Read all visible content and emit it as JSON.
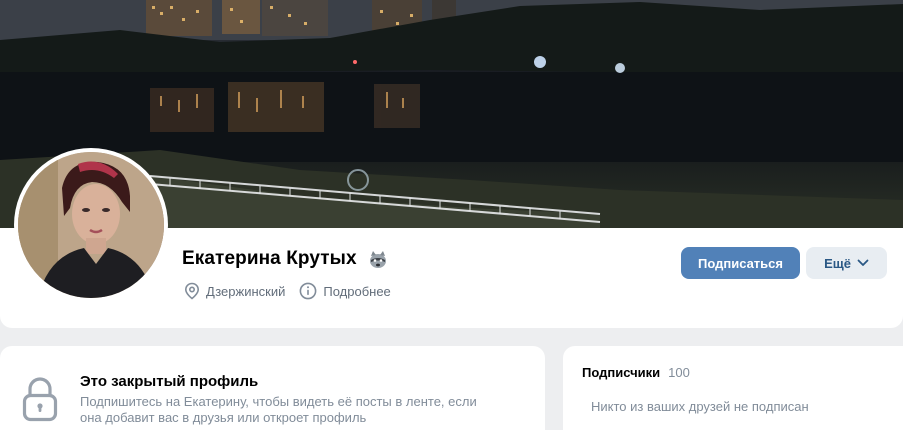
{
  "profile": {
    "name": "Екатерина Крутых",
    "city": "Дзержинский",
    "details_label": "Подробнее"
  },
  "actions": {
    "subscribe_label": "Подписаться",
    "more_label": "Ещё"
  },
  "private_profile": {
    "title": "Это закрытый профиль",
    "description": "Подпишитесь на Екатерину, чтобы видеть её посты в ленте, если она добавит вас в друзья или откроет профиль"
  },
  "followers": {
    "title": "Подписчики",
    "count": "100",
    "empty_text": "Никто из ваших друзей не подписан"
  },
  "colors": {
    "accent": "#5181b8",
    "secondary_button_bg": "#e8edf2",
    "secondary_button_text": "#2a5885",
    "page_bg": "#edeef0",
    "muted_text": "#818c99"
  },
  "icons": {
    "location": "location-pin-icon",
    "info": "info-circle-icon",
    "dropdown": "chevron-down-icon",
    "private": "lock-icon",
    "status_emoji": "raccoon-emoji-icon"
  }
}
